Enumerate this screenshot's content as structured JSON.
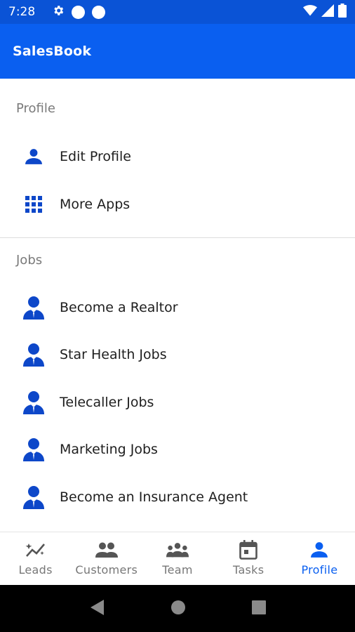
{
  "status_bar": {
    "time": "7:28",
    "icons": [
      "gear-icon",
      "notification-dot",
      "notification-dot",
      "wifi-icon",
      "signal-icon",
      "battery-icon"
    ]
  },
  "app_bar": {
    "title": "SalesBook"
  },
  "sections": {
    "profile": {
      "header": "Profile",
      "items": [
        {
          "label": "Edit Profile",
          "icon": "person-icon"
        },
        {
          "label": "More Apps",
          "icon": "apps-grid-icon"
        }
      ]
    },
    "jobs": {
      "header": "Jobs",
      "items": [
        {
          "label": "Become a Realtor",
          "icon": "businessman-icon"
        },
        {
          "label": "Star Health Jobs",
          "icon": "businessman-icon"
        },
        {
          "label": "Telecaller Jobs",
          "icon": "businessman-icon"
        },
        {
          "label": "Marketing Jobs",
          "icon": "businessman-icon"
        },
        {
          "label": "Become an Insurance Agent",
          "icon": "businessman-icon"
        }
      ]
    }
  },
  "bottom_nav": {
    "active": "Profile",
    "items": [
      {
        "label": "Leads",
        "icon": "trending-icon"
      },
      {
        "label": "Customers",
        "icon": "people-icon"
      },
      {
        "label": "Team",
        "icon": "group-icon"
      },
      {
        "label": "Tasks",
        "icon": "calendar-icon"
      },
      {
        "label": "Profile",
        "icon": "person-icon"
      }
    ]
  },
  "colors": {
    "status_bar": "#0a53d6",
    "app_bar": "#0a5ff0",
    "accent": "#0a5ff0",
    "icon_blue": "#0d47c9"
  }
}
